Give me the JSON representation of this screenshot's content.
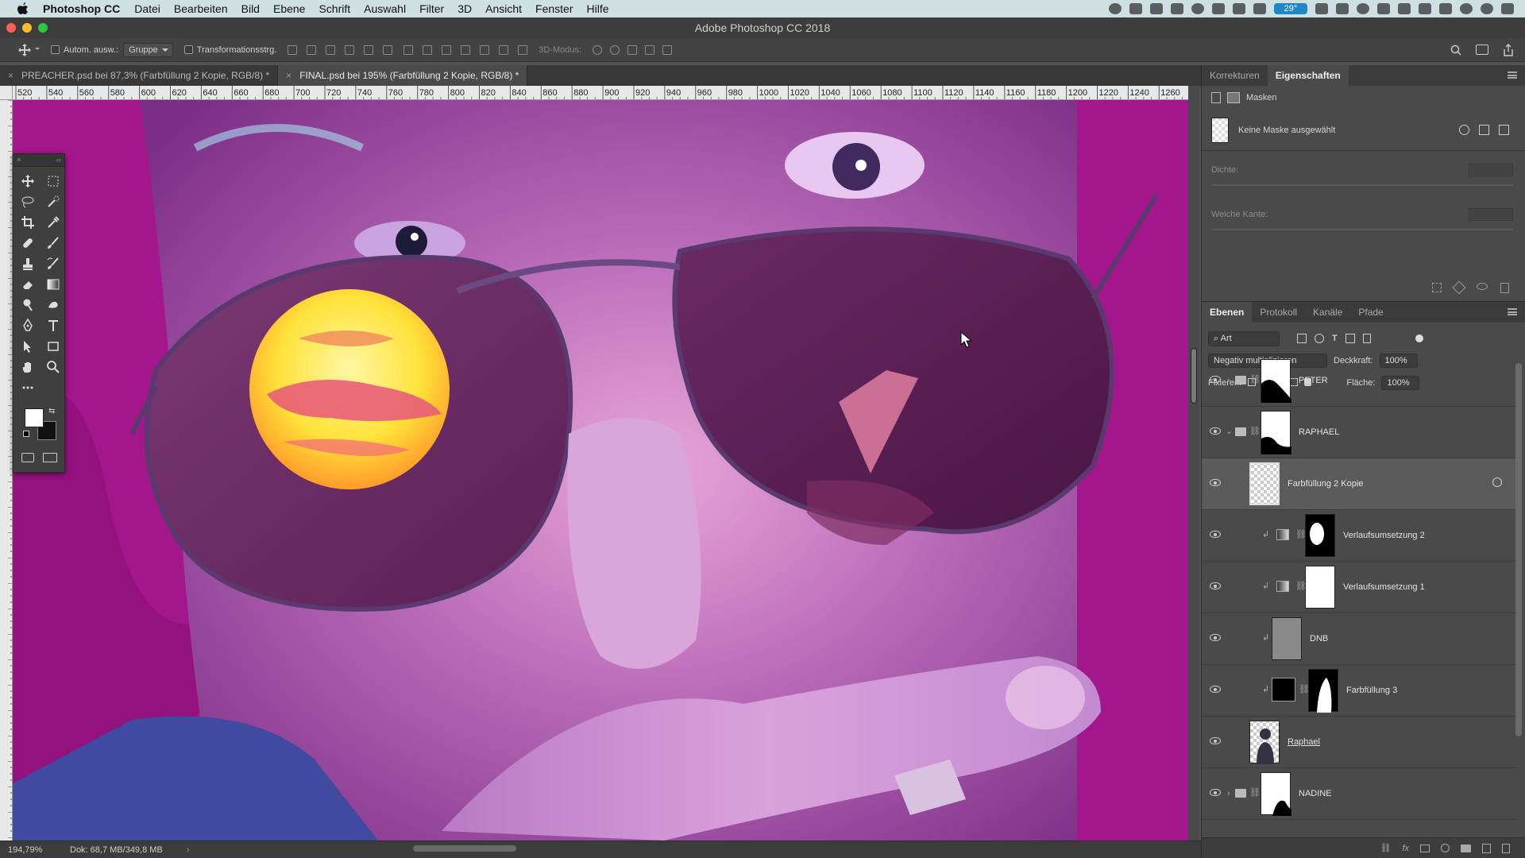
{
  "menubar": {
    "app": "Photoshop CC",
    "items": [
      "Datei",
      "Bearbeiten",
      "Bild",
      "Ebene",
      "Schrift",
      "Auswahl",
      "Filter",
      "3D",
      "Ansicht",
      "Fenster",
      "Hilfe"
    ],
    "weather": "29°"
  },
  "window": {
    "title": "Adobe Photoshop CC 2018"
  },
  "options": {
    "auto_select": "Autom. ausw.:",
    "auto_select_target": "Gruppe",
    "transform": "Transformationsstrg.",
    "mode3d": "3D-Modus:"
  },
  "tabs": [
    {
      "label": "PREACHER.psd bei 87,3% (Farbfüllung 2 Kopie, RGB/8) *"
    },
    {
      "label": "FINAL.psd bei 195% (Farbfüllung 2 Kopie, RGB/8) *"
    }
  ],
  "ruler_h": [
    "520",
    "540",
    "560",
    "580",
    "600",
    "620",
    "640",
    "660",
    "680",
    "700",
    "720",
    "740",
    "760",
    "780",
    "800",
    "820",
    "840",
    "860",
    "880",
    "900",
    "920",
    "940",
    "960",
    "980",
    "1000",
    "1020",
    "1040",
    "1060",
    "1080",
    "1100",
    "1120",
    "1140",
    "1160",
    "1180",
    "1200",
    "1220",
    "1240",
    "1260"
  ],
  "status": {
    "zoom": "194,79%",
    "doc": "Dok: 68,7 MB/349,8 MB"
  },
  "panel_top": {
    "tabs": [
      "Korrekturen",
      "Eigenschaften"
    ],
    "section": "Masken",
    "mask_status": "Keine Maske ausgewählt",
    "density": "Dichte:",
    "feather": "Weiche Kante:"
  },
  "panel_layers": {
    "tabs": [
      "Ebenen",
      "Protokoll",
      "Kanäle",
      "Pfade"
    ],
    "filter": "Art",
    "blend_mode": "Negativ multiplizieren",
    "opacity_label": "Deckkraft:",
    "opacity": "100%",
    "lock_label": "Fixieren:",
    "fill_label": "Fläche:",
    "fill": "100%",
    "layers": [
      {
        "name": "PETER"
      },
      {
        "name": "RAPHAEL"
      },
      {
        "name": "Farbfüllung 2 Kopie"
      },
      {
        "name": "Verlaufsumsetzung 2"
      },
      {
        "name": "Verlaufsumsetzung 1"
      },
      {
        "name": "DNB"
      },
      {
        "name": "Farbfüllung 3"
      },
      {
        "name": "Raphael"
      },
      {
        "name": "NADINE"
      }
    ]
  }
}
